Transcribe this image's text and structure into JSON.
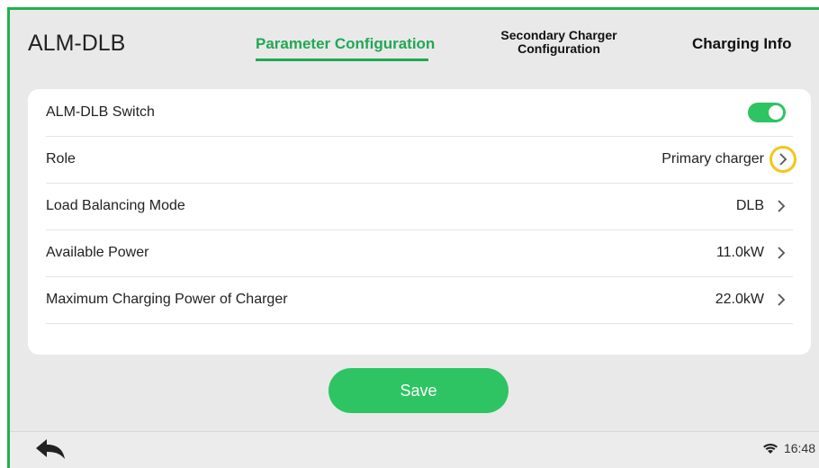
{
  "header": {
    "title": "ALM-DLB",
    "tabs": [
      {
        "label": "Parameter Configuration"
      },
      {
        "label_line1": "Secondary Charger",
        "label_line2": "Configuration"
      },
      {
        "label": "Charging Info"
      }
    ]
  },
  "settings": {
    "rows": [
      {
        "label": "ALM-DLB Switch",
        "toggle_on": true
      },
      {
        "label": "Role",
        "value": "Primary charger"
      },
      {
        "label": "Load Balancing Mode",
        "value": "DLB"
      },
      {
        "label": "Available Power",
        "value": "11.0kW"
      },
      {
        "label": "Maximum Charging Power of Charger",
        "value": "22.0kW"
      }
    ]
  },
  "actions": {
    "save_label": "Save"
  },
  "status_bar": {
    "time": "16:48",
    "icons": [
      "back-arrow-icon",
      "wifi-icon"
    ]
  },
  "colors": {
    "accent": "#21a853",
    "toggle": "#2ec463",
    "highlight_ring": "#f5c518",
    "frame": "#22b14c"
  }
}
